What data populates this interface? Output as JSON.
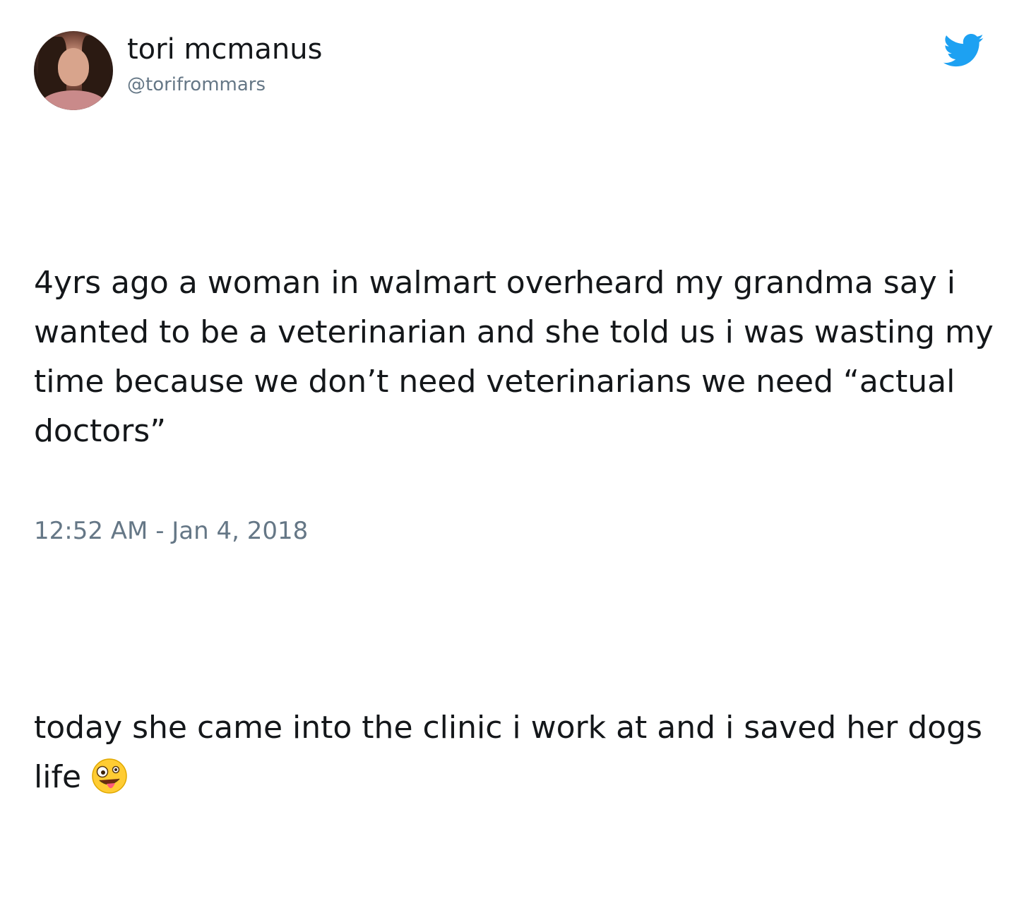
{
  "user": {
    "display_name": "tori mcmanus",
    "handle": "@torifrommars"
  },
  "tweet": {
    "paragraph_1": "4yrs ago a woman in walmart overheard my grandma say i wanted to be a veterinarian and she told us i was wasting my time because we don’t need veterinarians we need “actual doctors”",
    "paragraph_2": "today she came into the clinic i work at and i saved her dogs life",
    "emoji": "zany-face-emoji",
    "timestamp": "12:52 AM - Jan 4, 2018"
  },
  "icons": {
    "brand": "twitter-bird-icon",
    "brand_color": "#1da1f2"
  },
  "colors": {
    "text": "#14171a",
    "secondary_text": "#657786",
    "background": "#ffffff"
  }
}
